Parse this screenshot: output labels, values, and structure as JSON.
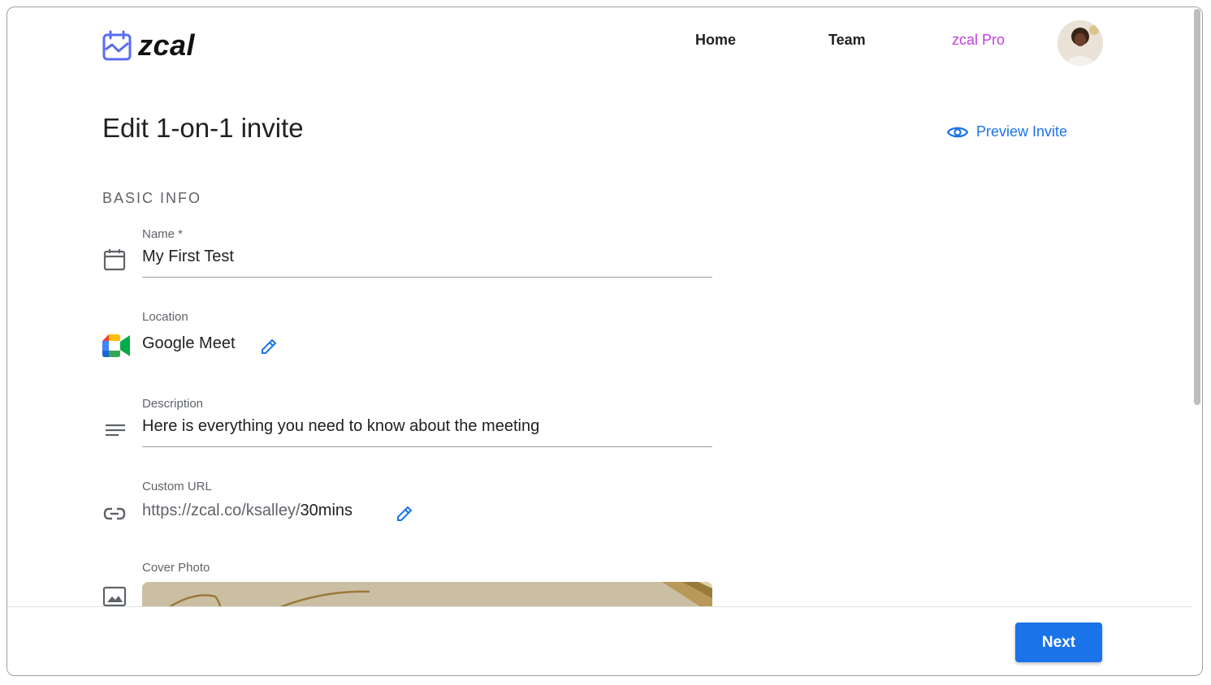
{
  "header": {
    "logo_text": "zcal",
    "nav": {
      "home": "Home",
      "team": "Team",
      "pro": "zcal Pro"
    }
  },
  "page": {
    "title": "Edit 1-on-1 invite",
    "preview_label": "Preview Invite",
    "section_label": "BASIC INFO"
  },
  "fields": {
    "name": {
      "label": "Name *",
      "value": "My First Test"
    },
    "location": {
      "label": "Location",
      "value": "Google Meet"
    },
    "description": {
      "label": "Description",
      "value": "Here is everything you need to know about the meeting"
    },
    "custom_url": {
      "label": "Custom URL",
      "prefix": "https://zcal.co/ksalley/",
      "slug": "30mins"
    },
    "cover_photo": {
      "label": "Cover Photo"
    }
  },
  "footer": {
    "next_label": "Next"
  },
  "colors": {
    "accent": "#1a73e8",
    "pro": "#c040e0"
  },
  "icons": [
    "zcal-logo-icon",
    "eye-icon",
    "calendar-icon",
    "google-meet-icon",
    "pencil-icon",
    "notes-icon",
    "link-icon",
    "image-icon"
  ]
}
